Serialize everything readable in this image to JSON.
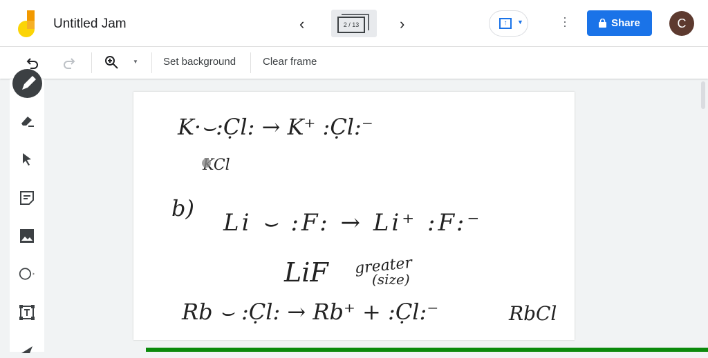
{
  "header": {
    "title": "Untitled Jam",
    "frame_indicator": "2 / 13",
    "share_label": "Share",
    "avatar_initial": "C"
  },
  "toolbar": {
    "set_background": "Set background",
    "clear_frame": "Clear frame"
  },
  "canvas": {
    "lines": [
      "K·⌣:C̣l: → K⁺ :C̣l:⁻",
      "KCl",
      "b)",
      "Li ⌣ :F: → Li⁺ :F:⁻",
      "LiF",
      "greater",
      "(size)",
      "Rb ⌣ :C̣l: → Rb⁺ + :C̣l:⁻",
      "RbCl"
    ]
  },
  "colors": {
    "accent": "#1a73e8",
    "progress": "#0b8a0b",
    "avatar": "#5d3a2f"
  }
}
